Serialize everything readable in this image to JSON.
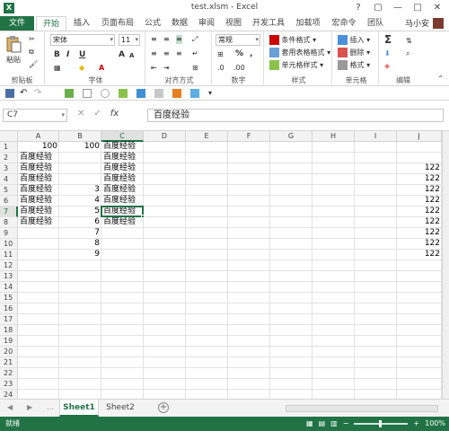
{
  "window": {
    "title": "test.xlsm - Excel",
    "controls": {
      "help": "?",
      "restore": "▢",
      "minimize": "—",
      "maximize": "□",
      "close": "✕"
    }
  },
  "ribbon_tabs": [
    "文件",
    "开始",
    "插入",
    "页面布局",
    "公式",
    "数据",
    "审阅",
    "视图",
    "开发工具",
    "加载项",
    "宏命令",
    "团队"
  ],
  "user": {
    "name": "马小安"
  },
  "ribbon": {
    "clipboard": {
      "paste": "粘贴",
      "label": "剪贴板"
    },
    "font": {
      "name": "宋体",
      "size": "11",
      "label": "字体",
      "bold": "B",
      "italic": "I",
      "underline": "U",
      "grow": "A",
      "shrink": "A"
    },
    "alignment": {
      "label": "对齐方式"
    },
    "number": {
      "format": "常规",
      "label": "数字",
      "percent": "%",
      "comma": ","
    },
    "styles": {
      "conditional": "条件格式",
      "table": "套用表格格式",
      "cell": "单元格样式",
      "label": "样式"
    },
    "cells": {
      "insert": "插入",
      "delete": "删除",
      "format": "格式",
      "label": "单元格"
    },
    "editing": {
      "label": "编辑",
      "sum": "Σ"
    }
  },
  "formula_bar": {
    "name_box": "C7",
    "cancel": "✕",
    "enter": "✓",
    "fx": "fx",
    "content": "百度经验"
  },
  "columns": [
    "A",
    "B",
    "C",
    "D",
    "E",
    "F",
    "G",
    "H",
    "I",
    "J"
  ],
  "selected_column": "C",
  "selected_row": "7",
  "rows": [
    "1",
    "2",
    "3",
    "4",
    "5",
    "6",
    "7",
    "8",
    "9",
    "10",
    "11",
    "12",
    "13",
    "14",
    "15",
    "16",
    "17",
    "18",
    "19",
    "20",
    "21",
    "22",
    "23",
    "24"
  ],
  "cells": {
    "A": [
      "100",
      "百度经验",
      "百度经验",
      "百度经验",
      "百度经验",
      "百度经验",
      "百度经验",
      "百度经验"
    ],
    "B": [
      "100",
      "",
      "",
      "",
      "3",
      "4",
      "5",
      "6",
      "7",
      "8",
      "9"
    ],
    "C": [
      "百度经验",
      "百度经验",
      "百度经验",
      "百度经验",
      "百度经验",
      "百度经验",
      "百度经验",
      "百度经验"
    ],
    "J": [
      "",
      "",
      "122",
      "122",
      "122",
      "122",
      "122",
      "122",
      "122",
      "122",
      "122"
    ]
  },
  "sheets": [
    "Sheet1",
    "Sheet2"
  ],
  "active_sheet": "Sheet1",
  "add_sheet": "+",
  "status": {
    "text": "就绪",
    "zoom": "100%",
    "zoom_minus": "−",
    "zoom_plus": "+"
  }
}
